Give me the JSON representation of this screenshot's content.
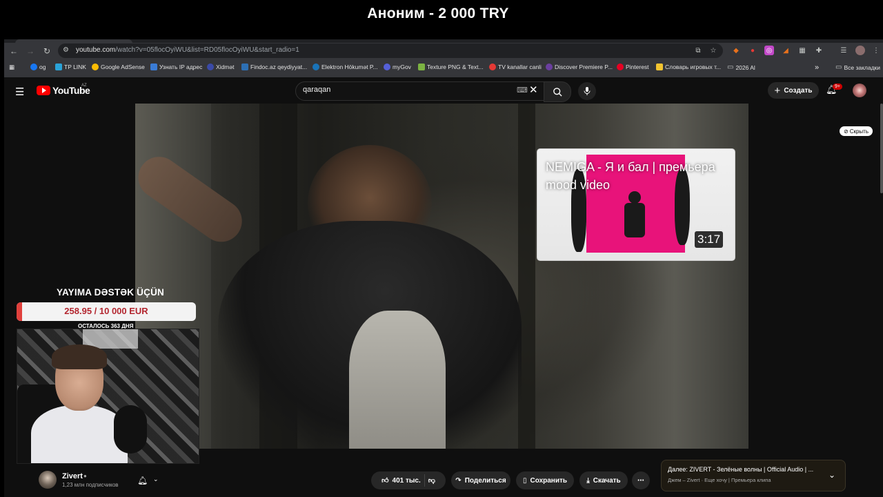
{
  "donation": {
    "title": "Аноним - 2 000 TRY"
  },
  "browser": {
    "url_main": "youtube.com",
    "url_rest": "/watch?v=05flocOyiWU&list=RD05flocOyiWU&start_radio=1",
    "bookmarks": [
      {
        "label": "og",
        "color": "#1877f2"
      },
      {
        "label": "TP LINK",
        "color": "#2aa3d8"
      },
      {
        "label": "Google AdSense",
        "color": "#fbbc04"
      },
      {
        "label": "Узнать IP адрес",
        "color": "#3a7bd5"
      },
      {
        "label": "Xidmət",
        "color": "#3b4aa8"
      },
      {
        "label": "Findoc.az qeydiyyat...",
        "color": "#2d6fb4"
      },
      {
        "label": "Elektron Hökumət P...",
        "color": "#1a73b8"
      },
      {
        "label": "myGov",
        "color": "#5560d8"
      },
      {
        "label": "Texture PNG & Text...",
        "color": "#7cb342"
      },
      {
        "label": "TV kanallar canli",
        "color": "#e53935"
      },
      {
        "label": "Discover Premiere P...",
        "color": "#6b3fa0"
      },
      {
        "label": "Pinterest",
        "color": "#e60023"
      },
      {
        "label": "Словарь игровых т...",
        "color": "#f4c430"
      },
      {
        "label": "2026 Al",
        "color": "#9aa0a6"
      }
    ],
    "more_bookmarks": "»",
    "all_bookmarks": "Все закладки"
  },
  "youtube": {
    "logo_text": "YouTube",
    "country": "AZ",
    "search_value": "qaraqan",
    "create_label": "Создать",
    "notifications_badge": "9+",
    "hide_label": "Скрыть"
  },
  "endcard": {
    "title": "NEMIGA - Я и бал | премьера mood video",
    "duration": "3:17"
  },
  "overlay": {
    "support_title": "YAYIMA DƏSTƏK ÜÇÜN",
    "goal_text": "258.95 / 10 000 EUR",
    "goal_current": 258.95,
    "goal_target": 10000,
    "days_left": "ОСТАЛОСЬ 363 ДНЯ"
  },
  "channel": {
    "name": "Zivert",
    "subscribers": "1,23 млн подписчиков"
  },
  "actions": {
    "likes": "401 тыс.",
    "share": "Поделиться",
    "save": "Сохранить",
    "download": "Скачать"
  },
  "next_up": {
    "title": "Далее: ZIVERT - Зелёные волны | Official Audio | ...",
    "subtitle": "Джем – Zivert · Еще хочу | Премьера клипа"
  },
  "icons": {
    "hamburger": "menu-icon",
    "search": "search-icon",
    "mic": "mic-icon",
    "bell": "bell-icon",
    "like": "thumbs-up-icon",
    "dislike": "thumbs-down-icon",
    "share": "share-icon",
    "save": "bookmark-icon",
    "download": "download-icon",
    "more": "more-icon"
  }
}
